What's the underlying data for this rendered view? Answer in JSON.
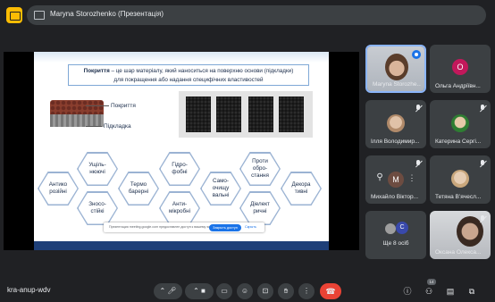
{
  "presenter_bar": {
    "text": "Maryna Storozhenko (Презентація)"
  },
  "slide": {
    "title_bold": "Покриття",
    "title_rest": " – це шар матеріалу, який наноситься на поверхню основи (підкладки)",
    "title_line2": "для покращення або надання специфічних властивостей",
    "label_coating": "Покриття",
    "label_substrate": "Підкладка",
    "hexes": [
      {
        "id": "hex-anticorrosion",
        "text": "Антико\nрозійні"
      },
      {
        "id": "hex-hardening",
        "text": "Ущіль-\nнюючі"
      },
      {
        "id": "hex-wear",
        "text": "Зносо-\nстійкі"
      },
      {
        "id": "hex-thermal",
        "text": "Термо\nбарерні"
      },
      {
        "id": "hex-hydrophobic",
        "text": "Гідро-\nфобні"
      },
      {
        "id": "hex-antimicrobial",
        "text": "Анти-\nмікробні"
      },
      {
        "id": "hex-selfcleaning",
        "text": "Само-\nочищу\nвальні"
      },
      {
        "id": "hex-antifouling",
        "text": "Проти\nобро-\nстання"
      },
      {
        "id": "hex-dielectric",
        "text": "Діелект\nричні"
      },
      {
        "id": "hex-decorative",
        "text": "Декора\nтивні"
      }
    ]
  },
  "notice": {
    "text": "Презентация meeting.google.com предоставлен доступ к вашему экрану",
    "button": "Закрыть доступ",
    "link": "Скрыть"
  },
  "participants": [
    {
      "name": "Maryna Storozhenko",
      "display": "Maryna Storozhe..."
    },
    {
      "name": "Ольга Андріївна",
      "display": "Ольга Андріївн..."
    },
    {
      "name": "Ілля Володимирович",
      "display": "Ілля Володимир..."
    },
    {
      "name": "Катерина Сергіївна",
      "display": "Катерина Сергі..."
    },
    {
      "name": "Михайло Вікторович",
      "display": "Михайло Віктор..."
    },
    {
      "name": "Тетяна В'ячеславівна",
      "display": "Тетяна В’ячесл..."
    },
    {
      "name": "Ще 8 осіб",
      "display": "Ще 8 осіб"
    },
    {
      "name": "Оксана Олександрівна",
      "display": "Оксана Олекса..."
    }
  ],
  "avatar_letters": {
    "olga": "О",
    "mykhailo": "М",
    "more_1": "С"
  },
  "bottom_bar": {
    "meeting_code": "kra-anup-wdv",
    "participant_count": "14"
  },
  "colors": {
    "background": "#202124",
    "tile": "#3c4043",
    "accent": "#8ab4f8",
    "end_call": "#ea4335",
    "avatar_olga": "#c2185b",
    "avatar_mykhailo": "#6d4c41",
    "avatar_more": "#3949ab"
  },
  "icons": {
    "top": [
      "present-to-all-icon"
    ],
    "controls": [
      "mic-icon",
      "camera-icon",
      "captions-icon",
      "emoji-icon",
      "present-icon",
      "raise-hand-icon",
      "more-options-icon",
      "end-call-icon"
    ],
    "right": [
      "info-icon",
      "people-icon",
      "chat-icon",
      "activities-icon"
    ]
  }
}
